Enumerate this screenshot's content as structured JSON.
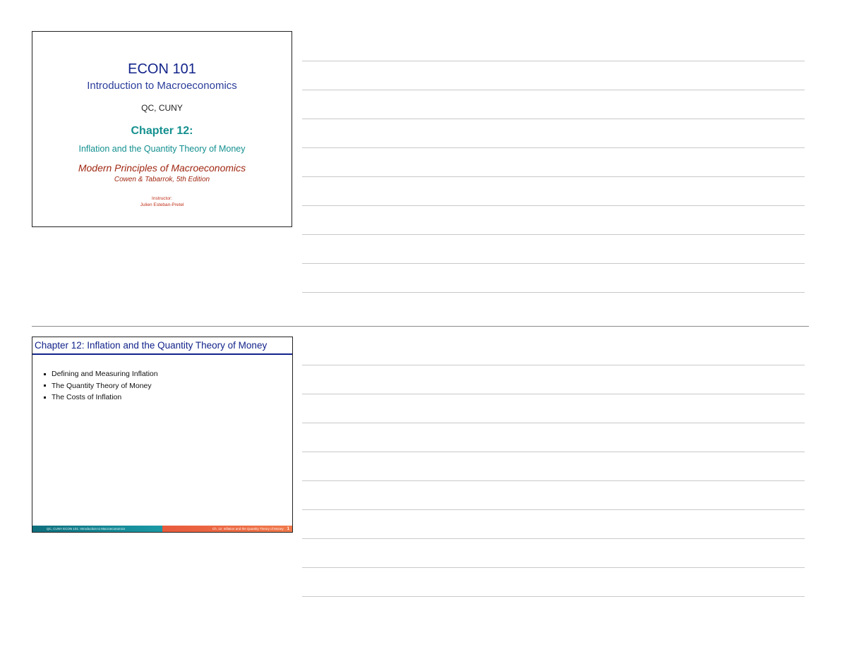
{
  "slide1": {
    "course": "ECON 101",
    "subtitle": "Introduction to Macroeconomics",
    "school": "QC, CUNY",
    "chapter": "Chapter 12:",
    "chapter_title": "Inflation and the Quantity Theory of Money",
    "book": "Modern Principles of Macroeconomics",
    "authors": "Cowen & Tabarrok, 5th Edition",
    "instructor_label": "Instructor:",
    "instructor_name": "Julien Esteban-Pretel"
  },
  "slide2": {
    "title": "Chapter 12: Inflation and the Quantity Theory of Money",
    "bullets": [
      "Defining and Measuring Inflation",
      "The Quantity Theory of Money",
      "The Costs of Inflation"
    ],
    "footer_left": "QC, CUNY   ECON 101: Introduction to Macroeconomics",
    "footer_right": "Ch. 12: Inflation and the Quantity Theory of Money",
    "page_number": "1"
  },
  "colors": {
    "title_blue": "#12238a",
    "teal": "#14908f",
    "book_red": "#a02812",
    "footer_teal": "#0f6f7d",
    "footer_orange": "#e85a3c"
  }
}
